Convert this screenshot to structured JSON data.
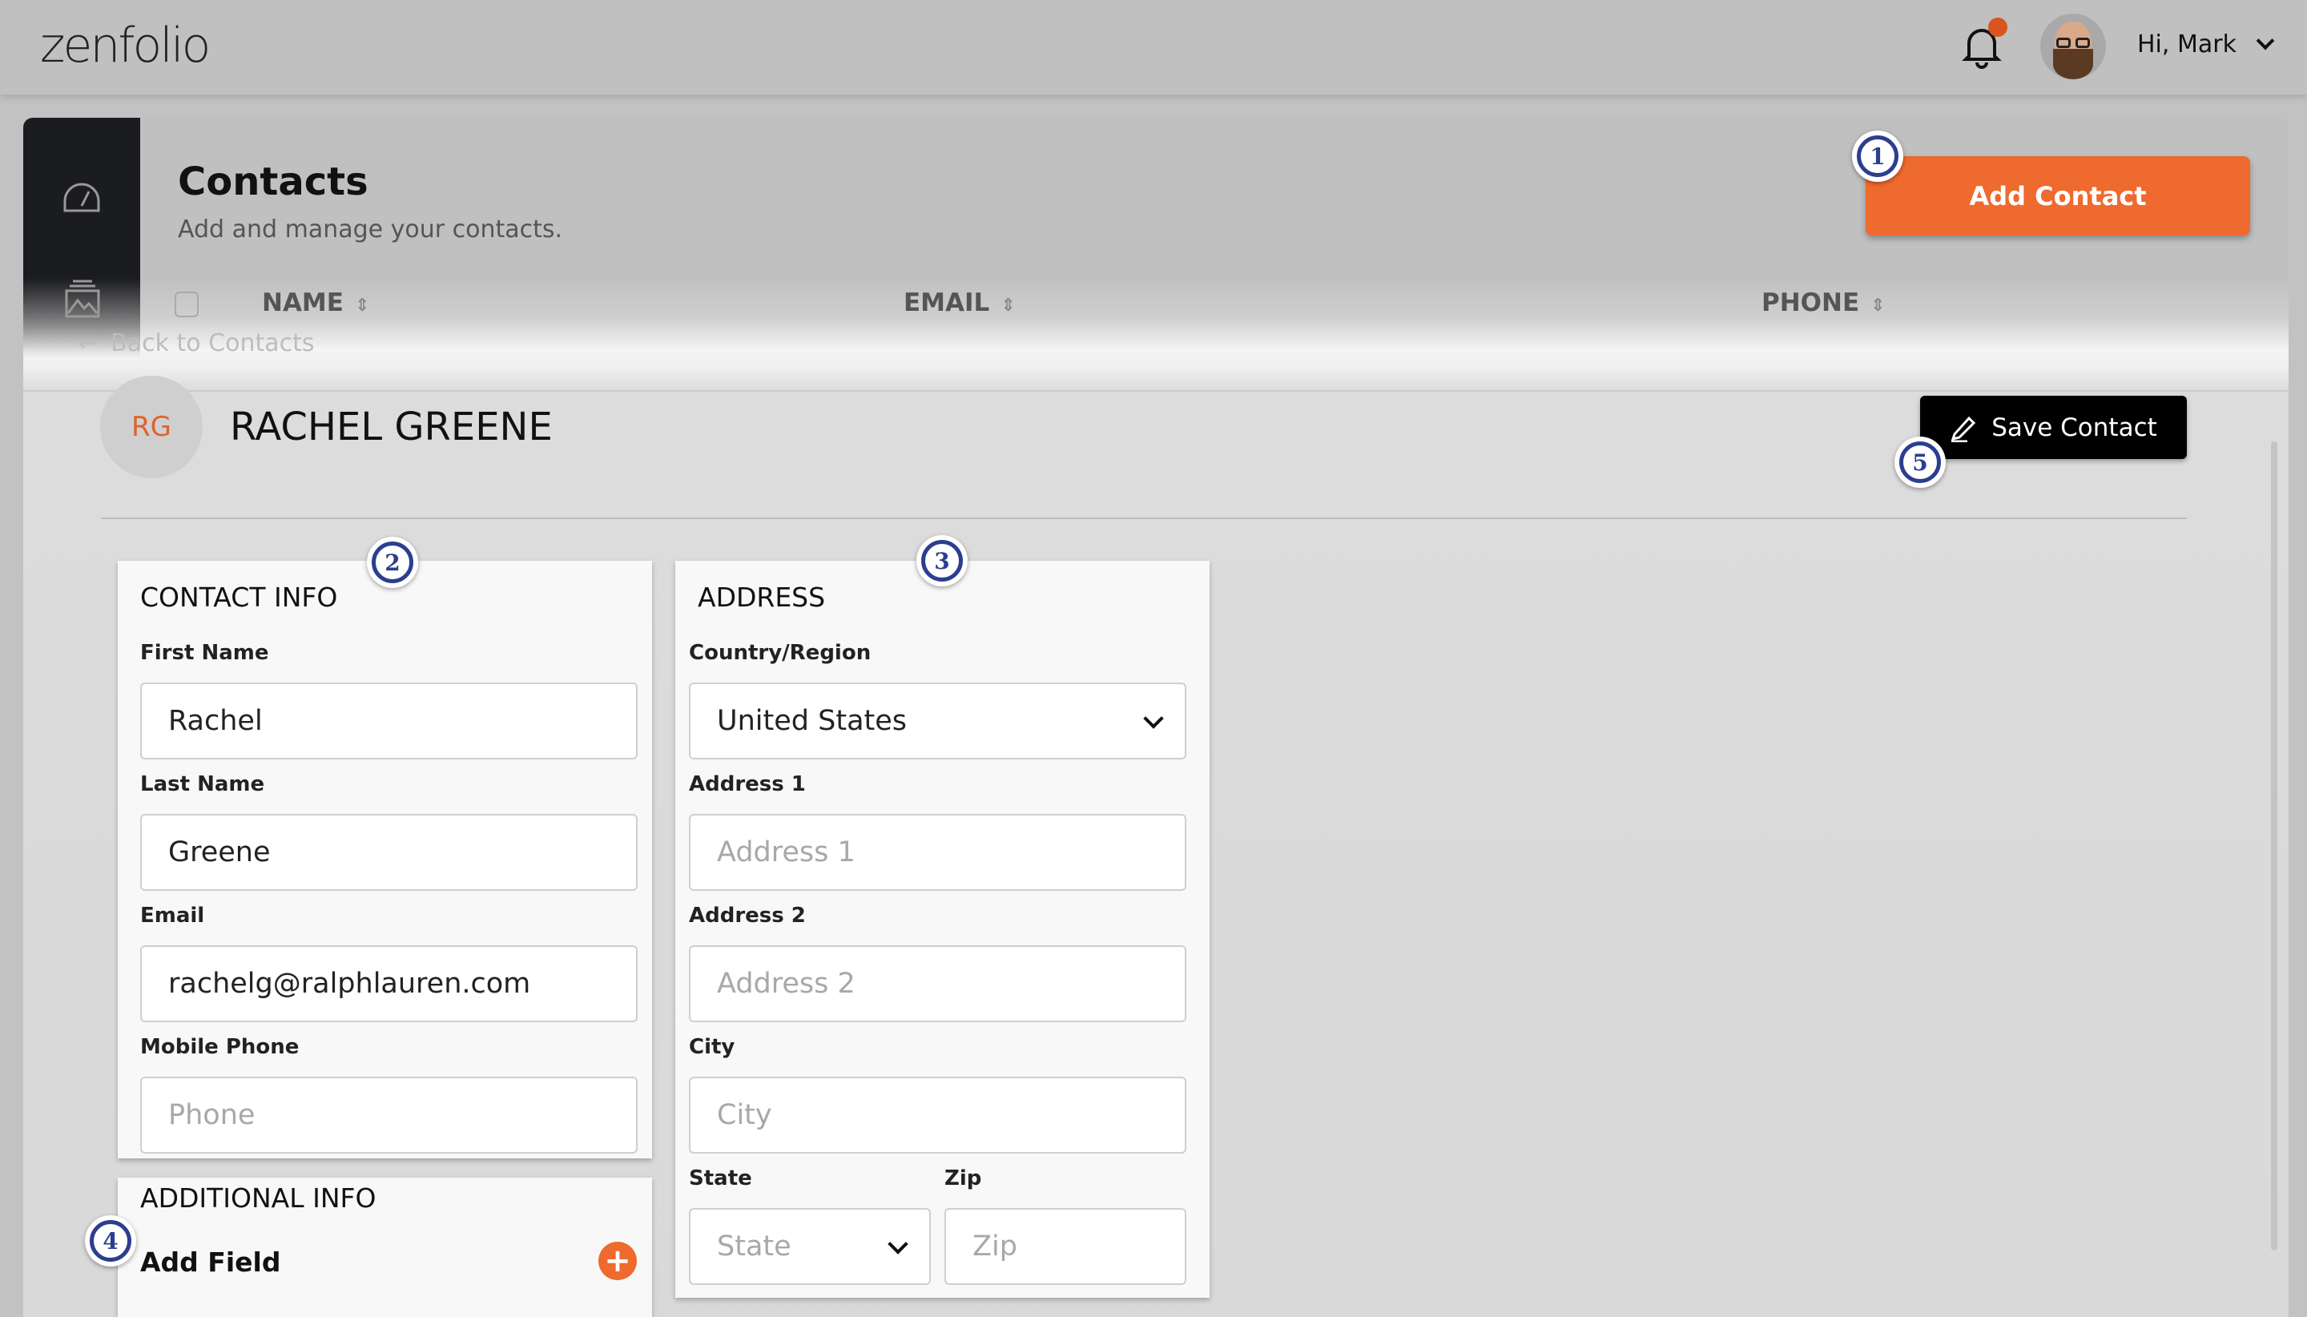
{
  "header": {
    "logo": "zenfolio",
    "greeting": "Hi, Mark",
    "notification_dot_color": "#d9541e",
    "icons": [
      "bell-icon",
      "avatar",
      "chevron-down-icon"
    ]
  },
  "contacts_page": {
    "title": "Contacts",
    "subtitle": "Add and manage your contacts.",
    "add_button": "Add Contact",
    "columns": [
      "NAME",
      "EMAIL",
      "PHONE"
    ],
    "sidebar_icons": [
      "dashboard-gauge-icon",
      "gallery-image-icon"
    ]
  },
  "detail": {
    "back_link": "Back to Contacts",
    "initials": "RG",
    "name": "RACHEL GREENE",
    "save_button": "Save Contact"
  },
  "contact_info": {
    "heading": "CONTACT INFO",
    "first_name_label": "First Name",
    "first_name": "Rachel",
    "last_name_label": "Last Name",
    "last_name": "Greene",
    "email_label": "Email",
    "email": "rachelg@ralphlauren.com",
    "phone_label": "Mobile Phone",
    "phone_placeholder": "Phone"
  },
  "additional_info": {
    "heading": "ADDITIONAL INFO",
    "add_field": "Add Field"
  },
  "address": {
    "heading": "ADDRESS",
    "country_label": "Country/Region",
    "country": "United States",
    "address1_label": "Address 1",
    "address1_placeholder": "Address 1",
    "address2_label": "Address 2",
    "address2_placeholder": "Address 2",
    "city_label": "City",
    "city_placeholder": "City",
    "state_label": "State",
    "state_placeholder": "State",
    "zip_label": "Zip",
    "zip_placeholder": "Zip"
  },
  "annotations": [
    "1",
    "2",
    "3",
    "4",
    "5"
  ],
  "colors": {
    "accent": "#ee6a2e",
    "badge": "#2c3e8f",
    "save_button": "#000000"
  }
}
